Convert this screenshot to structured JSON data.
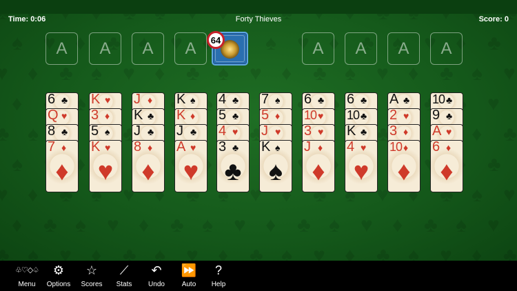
{
  "header": {
    "time": "Time: 0:06",
    "title": "Forty Thieves",
    "score": "Score: 0"
  },
  "foundation_label": "A",
  "stock": {
    "count": "64"
  },
  "tableau": [
    {
      "cards": [
        {
          "rank": "6",
          "suit": "♣",
          "color": "black"
        },
        {
          "rank": "Q",
          "suit": "♥",
          "color": "red"
        },
        {
          "rank": "8",
          "suit": "♣",
          "color": "black"
        },
        {
          "rank": "7",
          "suit": "♦",
          "color": "red"
        }
      ]
    },
    {
      "cards": [
        {
          "rank": "K",
          "suit": "♥",
          "color": "red"
        },
        {
          "rank": "3",
          "suit": "♦",
          "color": "red"
        },
        {
          "rank": "5",
          "suit": "♠",
          "color": "black"
        },
        {
          "rank": "K",
          "suit": "♥",
          "color": "red"
        }
      ]
    },
    {
      "cards": [
        {
          "rank": "J",
          "suit": "♦",
          "color": "red"
        },
        {
          "rank": "K",
          "suit": "♣",
          "color": "black"
        },
        {
          "rank": "J",
          "suit": "♣",
          "color": "black"
        },
        {
          "rank": "8",
          "suit": "♦",
          "color": "red"
        }
      ]
    },
    {
      "cards": [
        {
          "rank": "K",
          "suit": "♠",
          "color": "black"
        },
        {
          "rank": "K",
          "suit": "♦",
          "color": "red"
        },
        {
          "rank": "J",
          "suit": "♣",
          "color": "black"
        },
        {
          "rank": "A",
          "suit": "♥",
          "color": "red"
        }
      ]
    },
    {
      "cards": [
        {
          "rank": "4",
          "suit": "♣",
          "color": "black"
        },
        {
          "rank": "5",
          "suit": "♣",
          "color": "black"
        },
        {
          "rank": "4",
          "suit": "♥",
          "color": "red"
        },
        {
          "rank": "3",
          "suit": "♣",
          "color": "black"
        }
      ]
    },
    {
      "cards": [
        {
          "rank": "7",
          "suit": "♠",
          "color": "black"
        },
        {
          "rank": "5",
          "suit": "♦",
          "color": "red"
        },
        {
          "rank": "J",
          "suit": "♥",
          "color": "red"
        },
        {
          "rank": "K",
          "suit": "♠",
          "color": "black"
        }
      ]
    },
    {
      "cards": [
        {
          "rank": "6",
          "suit": "♣",
          "color": "black"
        },
        {
          "rank": "10",
          "suit": "♥",
          "color": "red"
        },
        {
          "rank": "3",
          "suit": "♥",
          "color": "red"
        },
        {
          "rank": "J",
          "suit": "♦",
          "color": "red"
        }
      ]
    },
    {
      "cards": [
        {
          "rank": "6",
          "suit": "♣",
          "color": "black"
        },
        {
          "rank": "10",
          "suit": "♣",
          "color": "black"
        },
        {
          "rank": "K",
          "suit": "♣",
          "color": "black"
        },
        {
          "rank": "4",
          "suit": "♥",
          "color": "red"
        }
      ]
    },
    {
      "cards": [
        {
          "rank": "A",
          "suit": "♣",
          "color": "black"
        },
        {
          "rank": "2",
          "suit": "♥",
          "color": "red"
        },
        {
          "rank": "3",
          "suit": "♦",
          "color": "red"
        },
        {
          "rank": "10",
          "suit": "♦",
          "color": "red"
        }
      ]
    },
    {
      "cards": [
        {
          "rank": "10",
          "suit": "♣",
          "color": "black"
        },
        {
          "rank": "9",
          "suit": "♣",
          "color": "black"
        },
        {
          "rank": "A",
          "suit": "♥",
          "color": "red"
        },
        {
          "rank": "6",
          "suit": "♦",
          "color": "red"
        }
      ]
    }
  ],
  "toolbar": [
    {
      "label": "Menu",
      "icon": "♧♡◇♤"
    },
    {
      "label": "Options",
      "icon": "⚙"
    },
    {
      "label": "Scores",
      "icon": "☆"
    },
    {
      "label": "Stats",
      "icon": "⟋"
    },
    {
      "label": "Undo",
      "icon": "↶"
    },
    {
      "label": "Auto",
      "icon": "⏩"
    },
    {
      "label": "Help",
      "icon": "?"
    }
  ],
  "colors": {
    "felt": "#1b6420",
    "card": "#f6ecd7",
    "red_suit": "#cf3a2a",
    "stock_back": "#2a6fb0",
    "badge_ring": "#c8202a"
  }
}
